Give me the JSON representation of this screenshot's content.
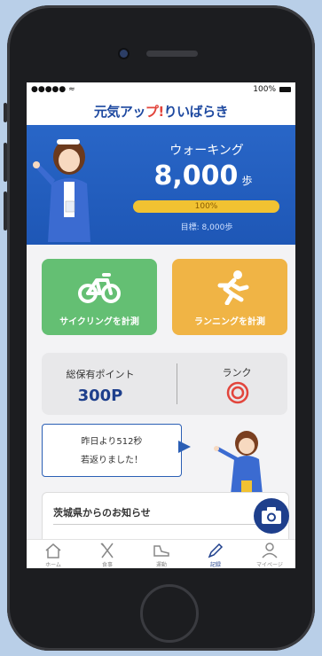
{
  "status": {
    "signal": "●●●●● ",
    "wifi": "≈",
    "battery": "100%"
  },
  "app": {
    "logo_main": "元気アッ",
    "logo_hl": "プ!",
    "logo_tail": "りいばらき"
  },
  "walking": {
    "label": "ウォーキング",
    "value": "8,000",
    "unit": "歩",
    "progress_text": "100%",
    "progress": 1.0,
    "goal": "目標: 8,000歩"
  },
  "buttons": {
    "cycling": "サイクリングを計測",
    "running": "ランニングを計測"
  },
  "points": {
    "label": "総保有ポイント",
    "value": "300P",
    "rank_label": "ランク"
  },
  "message": {
    "line1": "昨日より512秒",
    "line2": "若返りました！"
  },
  "news": {
    "title": "茨城県からのお知らせ"
  },
  "tabs": [
    {
      "label": "ホーム",
      "icon": "home-icon"
    },
    {
      "label": "食事",
      "icon": "fork-knife-icon"
    },
    {
      "label": "運動",
      "icon": "shoe-icon"
    },
    {
      "label": "記録",
      "icon": "pencil-icon"
    },
    {
      "label": "マイページ",
      "icon": "person-icon"
    }
  ],
  "colors": {
    "brand_blue": "#1e57b6",
    "cycle_green": "#64bf73",
    "run_orange": "#f0b445",
    "progress_yellow": "#f1c232",
    "rank_red": "#e2453c"
  }
}
